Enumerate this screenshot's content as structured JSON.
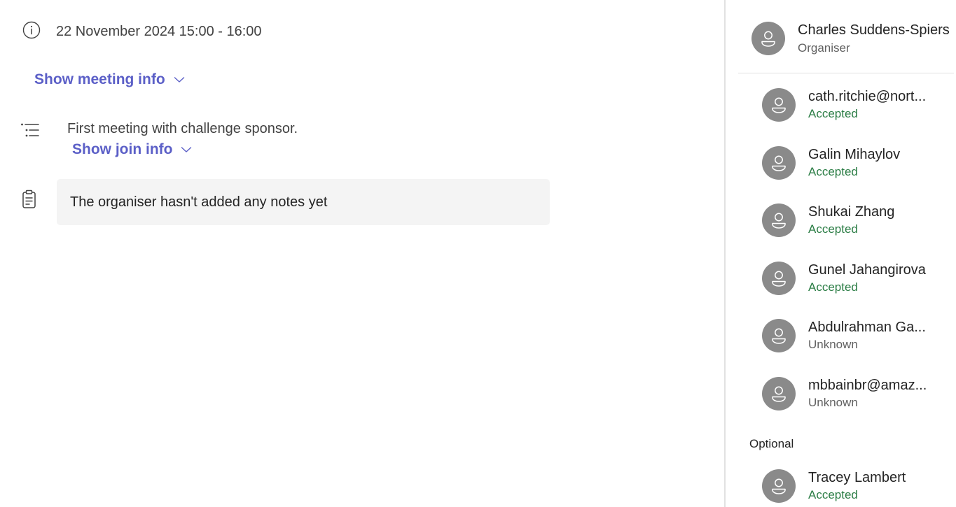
{
  "meeting": {
    "date_time": "22 November 2024 15:00 - 16:00",
    "show_meeting_info": "Show meeting info",
    "description": "First meeting with challenge sponsor.",
    "show_join_info": "Show join info",
    "notes_empty": "The organiser hasn't added any notes yet"
  },
  "organiser": {
    "name": "Charles Suddens-Spiers",
    "role": "Organiser"
  },
  "attendees": [
    {
      "name": "cath.ritchie@nort...",
      "status": "Accepted"
    },
    {
      "name": "Galin Mihaylov",
      "status": "Accepted"
    },
    {
      "name": "Shukai Zhang",
      "status": "Accepted"
    },
    {
      "name": "Gunel Jahangirova",
      "status": "Accepted"
    },
    {
      "name": "Abdulrahman Ga...",
      "status": "Unknown"
    },
    {
      "name": "mbbainbr@amaz...",
      "status": "Unknown"
    }
  ],
  "optional": {
    "label": "Optional",
    "attendees": [
      {
        "name": "Tracey Lambert",
        "status": "Accepted"
      }
    ]
  },
  "colors": {
    "link": "#5b5fc7",
    "accepted": "#2b7d45",
    "unknown": "#616161",
    "avatar": "#8a8a8a"
  }
}
